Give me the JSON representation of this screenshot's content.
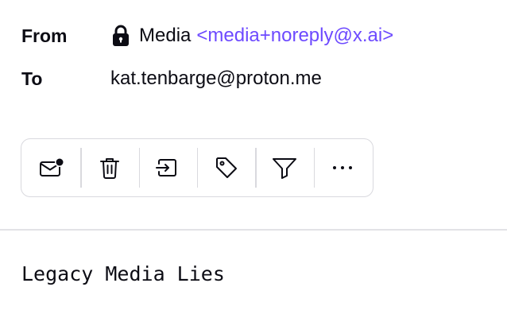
{
  "header": {
    "from_label": "From",
    "to_label": "To",
    "sender_name": "Media",
    "sender_email": "<media+noreply@x.ai>",
    "sender_icon": "lock-icon",
    "recipient": "kat.tenbarge@proton.me"
  },
  "toolbar": {
    "buttons": [
      {
        "icon": "mark-unread-icon",
        "label": "Mark as unread"
      },
      {
        "icon": "trash-icon",
        "label": "Move to trash"
      },
      {
        "icon": "move-to-folder-icon",
        "label": "Move to"
      },
      {
        "icon": "tag-icon",
        "label": "Label as"
      },
      {
        "icon": "filter-icon",
        "label": "Filter"
      },
      {
        "icon": "more-icon",
        "label": "More"
      }
    ]
  },
  "message": {
    "body": "Legacy Media Lies"
  },
  "colors": {
    "accent": "#6d4aff",
    "text": "#0c0c14",
    "border": "#d9d9de"
  }
}
